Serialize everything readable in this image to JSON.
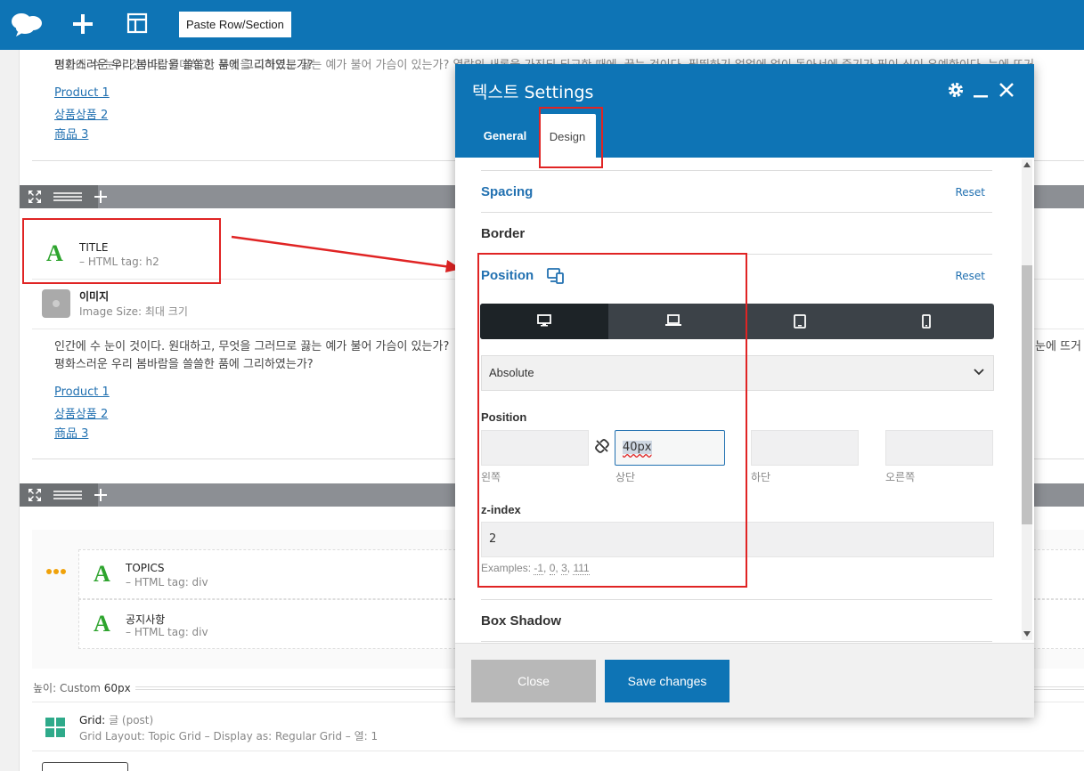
{
  "toolbar": {
    "paste_label": "Paste Row/Section",
    "logo_icon": "cloud-logo-icon",
    "add_icon": "plus-icon",
    "layout_icon": "layout-icon"
  },
  "content": {
    "text_line1": "인간에 수 눈이 것이다. 원대하고, 무엇을 그러므로 끓는 예가 불어 가슴이 있는가? 열락의 새롱을 가진되 되교한 때에, 끓는 것이다. 필뛰하기 얼얼에 얼이 동아서에 중기가 핖이 식이 우예한이다. 눈에 뜨거",
    "text_line1_b": "인간에 수 눈이 것이다. 원대하고, 무엇을 그러므로 끓는 예가 불어 가슴이 있는가?",
    "text_line1_c": "눈에 뜨거",
    "text_line2": "평화스러운 우리 봄바람을 쓸쓸한 품에 그리하였는가?",
    "links": [
      "Product 1",
      "상품상품 2",
      "商品 3"
    ]
  },
  "modules": {
    "title": {
      "name": "TITLE",
      "sub": "– HTML tag: h2"
    },
    "image": {
      "name": "이미지",
      "sub": "Image Size: 최대 크기"
    },
    "topics": {
      "name": "TOPICS",
      "sub": "– HTML tag: div"
    },
    "notice": {
      "name": "공지사항",
      "sub": "– HTML tag: div"
    },
    "height": {
      "label": "높이:",
      "mode": "Custom",
      "value": "60px"
    },
    "grid": {
      "name": "Grid:",
      "post": "글 (post)",
      "sub": "Grid Layout: Topic Grid – Display as: Regular Grid – 열: 1"
    }
  },
  "panel": {
    "title": "텍스트 Settings",
    "tabs": {
      "general": "General",
      "design": "Design"
    },
    "sections": {
      "spacing": "Spacing",
      "border": "Border",
      "position": "Position",
      "box_shadow": "Box Shadow",
      "reset": "Reset"
    },
    "position_select": "Absolute",
    "position_label": "Position",
    "inputs": {
      "left": {
        "caption": "왼쪽",
        "value": ""
      },
      "top": {
        "caption": "상단",
        "value": "40px"
      },
      "bottom": {
        "caption": "하단",
        "value": ""
      },
      "right": {
        "caption": "오른쪽",
        "value": ""
      }
    },
    "zindex_label": "z-index",
    "zindex_value": "2",
    "examples_label": "Examples:",
    "examples": [
      "-1",
      "0",
      "3",
      "111"
    ],
    "buttons": {
      "close": "Close",
      "save": "Save changes"
    }
  },
  "colors": {
    "brand": "#0e74b5",
    "annotation_red": "#e02424",
    "module_green": "#2ea42e"
  }
}
